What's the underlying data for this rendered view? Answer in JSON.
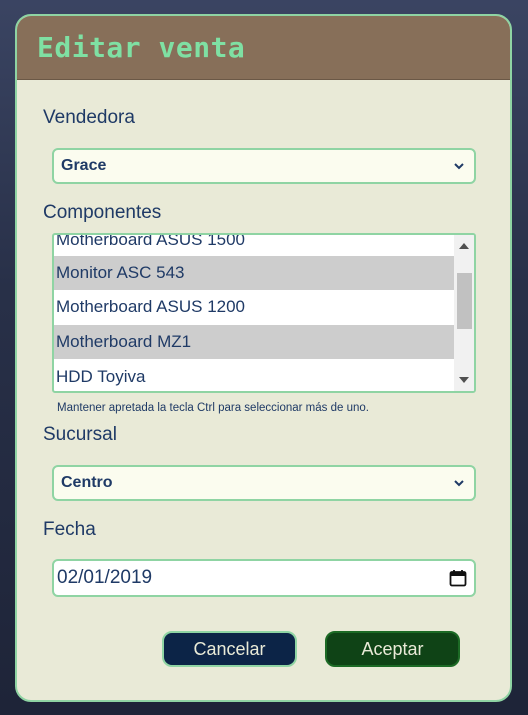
{
  "modal": {
    "title": "Editar venta"
  },
  "form": {
    "vendedora": {
      "label": "Vendedora",
      "selected": "Grace"
    },
    "componentes": {
      "label": "Componentes",
      "items": [
        {
          "label": "Motherboard ASUS 1500",
          "selected": false
        },
        {
          "label": "Monitor ASC 543",
          "selected": true
        },
        {
          "label": "Motherboard ASUS 1200",
          "selected": false
        },
        {
          "label": "Motherboard MZ1",
          "selected": true
        },
        {
          "label": "HDD Toyiva",
          "selected": false
        }
      ],
      "hint": "Mantener apretada la tecla Ctrl para seleccionar más de uno."
    },
    "sucursal": {
      "label": "Sucursal",
      "selected": "Centro"
    },
    "fecha": {
      "label": "Fecha",
      "value": "02/01/2019"
    }
  },
  "actions": {
    "cancel_label": "Cancelar",
    "accept_label": "Aceptar"
  },
  "icons": {
    "dropdown": "chevron-down-icon",
    "calendar": "calendar-icon"
  },
  "colors": {
    "header_bg": "#876f59",
    "title_color": "#7fe0a3",
    "border_accent": "#8fd4a3",
    "body_bg": "#e9ead7",
    "text": "#1f3a66",
    "cancel_bg": "#0c2447",
    "accept_bg": "#0f4316"
  }
}
